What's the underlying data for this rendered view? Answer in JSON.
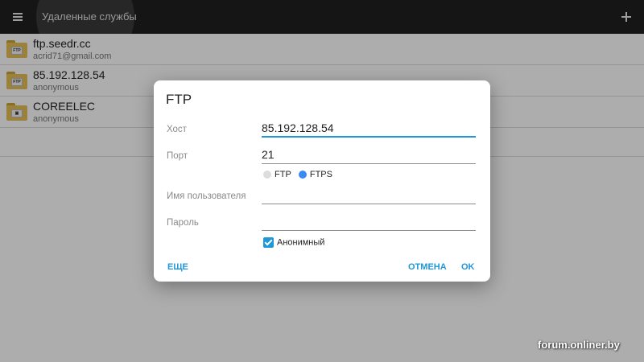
{
  "appbar": {
    "title": "Удаленные службы"
  },
  "services": [
    {
      "name": "ftp.seedr.cc",
      "user": "acrid71@gmail.com",
      "icon_badge": "FTP"
    },
    {
      "name": "85.192.128.54",
      "user": "anonymous",
      "icon_badge": "FTP"
    },
    {
      "name": "COREELEC",
      "user": "anonymous",
      "icon_badge": "▣"
    }
  ],
  "dialog": {
    "title": "FTP",
    "host": {
      "label": "Хост",
      "value": "85.192.128.54"
    },
    "port": {
      "label": "Порт",
      "value": "21"
    },
    "protocols": [
      {
        "label": "FTP",
        "selected": false
      },
      {
        "label": "FTPS",
        "selected": true
      }
    ],
    "username": {
      "label": "Имя пользователя",
      "value": ""
    },
    "password": {
      "label": "Пароль",
      "value": ""
    },
    "anonymous": {
      "label": "Анонимный",
      "checked": true
    },
    "buttons": {
      "more": "ЕЩЕ",
      "cancel": "ОТМЕНА",
      "ok": "OK"
    }
  },
  "watermark": "forum.onliner.by",
  "colors": {
    "accent": "#1f97d9",
    "radio_selected": "#3b8af0",
    "appbar": "#1f1f1f",
    "folder": "#e5bf55"
  }
}
